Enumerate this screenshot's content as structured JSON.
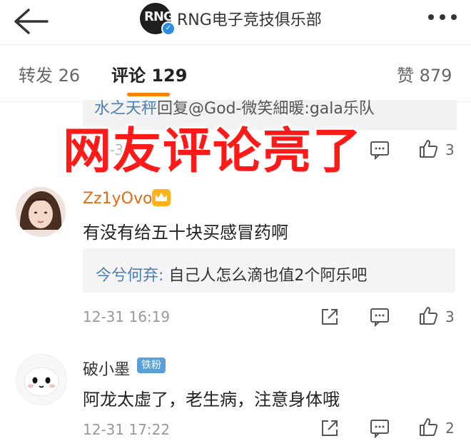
{
  "header": {
    "account_name": "RNG电子竞技俱乐部",
    "logo_text": "RNG"
  },
  "tabs": {
    "repost": "转发 26",
    "comments": "评论 129",
    "likes": "赞 879"
  },
  "overlay": {
    "headline": "网友评论亮了"
  },
  "top_reply": {
    "text_name": "水之天秤",
    "text_rest": "回复@God-微笑細暖:gala乐队",
    "timestamp": "12-31",
    "like_count": "3"
  },
  "comments": [
    {
      "username": "Zz1yOvo",
      "text": "有没有给五十块买感冒药啊",
      "reply": {
        "name": "今兮何弃:",
        "text": " 自己人怎么滴也值2个阿乐吧"
      },
      "timestamp": "12-31 16:19",
      "like_count": "3"
    },
    {
      "username": "破小墨",
      "badge": "铁粉",
      "text": "阿龙太虚了，老生病，注意身体哦",
      "timestamp": "12-31 17:22",
      "like_count": "2"
    }
  ],
  "colors": {
    "accent": "#ff8200",
    "headline": "#ff1a1a",
    "vip_name": "#e86a10",
    "link": "#4a7fb6"
  }
}
